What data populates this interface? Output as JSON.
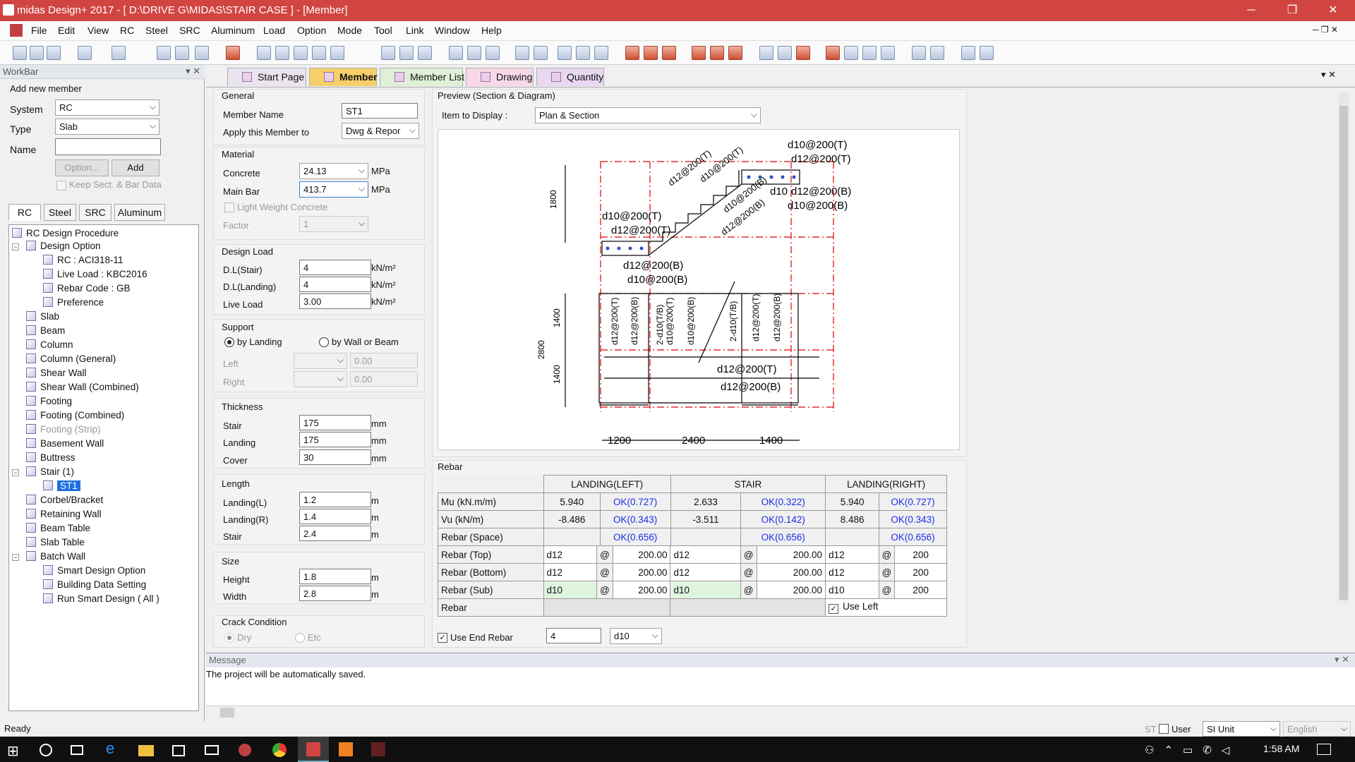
{
  "window": {
    "title": "midas Design+ 2017 - [ D:\\DRIVE G\\MIDAS\\STAIR CASE ] - [Member]",
    "minimize": "─",
    "restore": "❐",
    "close": "✕"
  },
  "menu": [
    "File",
    "Edit",
    "View",
    "RC",
    "Steel",
    "SRC",
    "Aluminum",
    "Load",
    "Option",
    "Mode",
    "Tool",
    "Link",
    "Window",
    "Help"
  ],
  "workbar": {
    "title": "WorkBar",
    "add_new_member": "Add new member",
    "system_label": "System",
    "system_value": "RC",
    "type_label": "Type",
    "type_value": "Slab",
    "name_label": "Name",
    "name_value": "",
    "option_button": "Option...",
    "add_button": "Add",
    "keep_sect": "Keep Sect. & Bar Data",
    "tabs": [
      "RC",
      "Steel",
      "SRC",
      "Aluminum"
    ],
    "tree": {
      "root": "RC Design Procedure",
      "design_option": "Design Option",
      "design_option_children": [
        "RC : ACI318-11",
        "Live Load : KBC2016",
        "Rebar Code : GB",
        "Preference"
      ],
      "items_a": [
        "Slab",
        "Beam",
        "Column",
        "Column (General)",
        "Shear Wall",
        "Shear Wall (Combined)",
        "Footing",
        "Footing (Combined)",
        "Footing (Strip)",
        "Basement Wall",
        "Buttress"
      ],
      "stair": "Stair (1)",
      "stair_child": "ST1",
      "items_b": [
        "Corbel/Bracket",
        "Retaining Wall",
        "Beam Table",
        "Slab Table"
      ],
      "batch": "Batch Wall",
      "batch_children": [
        "Smart Design Option",
        "Building Data Setting",
        "Run Smart Design ( All )"
      ]
    }
  },
  "tabs": [
    "Start Page",
    "Member",
    "Member List",
    "Drawing",
    "Quantity"
  ],
  "general": {
    "title": "General",
    "member_name_label": "Member Name",
    "member_name": "ST1",
    "apply_label": "Apply this Member to",
    "apply_value": "Dwg & Repor"
  },
  "material": {
    "title": "Material",
    "concrete_label": "Concrete",
    "concrete": "24.13",
    "mainbar_label": "Main Bar",
    "mainbar": "413.7",
    "unit": "MPa",
    "lwc": "Light Weight Concrete",
    "factor_label": "Factor",
    "factor": "1"
  },
  "design_load": {
    "title": "Design Load",
    "dl_stair_label": "D.L(Stair)",
    "dl_stair": "4",
    "dl_landing_label": "D.L(Landing)",
    "dl_landing": "4",
    "live_label": "Live Load",
    "live": "3.00",
    "unit": "kN/m²"
  },
  "support": {
    "title": "Support",
    "by_landing": "by Landing",
    "by_wall": "by Wall or Beam",
    "left_label": "Left",
    "left_value": "0.00",
    "right_label": "Right",
    "right_value": "0.00"
  },
  "thickness": {
    "title": "Thickness",
    "stair_label": "Stair",
    "stair": "175",
    "landing_label": "Landing",
    "landing": "175",
    "cover_label": "Cover",
    "cover": "30",
    "unit": "mm"
  },
  "length": {
    "title": "Length",
    "landing_l_label": "Landing(L)",
    "landing_l": "1.2",
    "landing_r_label": "Landing(R)",
    "landing_r": "1.4",
    "stair_label": "Stair",
    "stair": "2.4",
    "unit": "m"
  },
  "size": {
    "title": "Size",
    "height_label": "Height",
    "height": "1.8",
    "width_label": "Width",
    "width": "2.8",
    "unit": "m"
  },
  "crack": {
    "title": "Crack Condition",
    "dry": "Dry",
    "etc": "Etc"
  },
  "preview": {
    "title": "Preview (Section & Diagram)",
    "item_label": "Item to Display :",
    "item_value": "Plan & Section",
    "labels": {
      "d10_200_T": "d10@200(T)",
      "d12_200_T": "d12@200(T)",
      "d10": "d10",
      "d12_200_B": "d12@200(B)",
      "d10_200_B": "d10@200(B)",
      "dim_1800": "1800",
      "dim_1400": "1400",
      "dim_2800": "2800",
      "dim_1200": "1200",
      "dim_2400": "2400",
      "diag_d12_T": "d12@200(T)",
      "diag_d10_T": "d10@200(T)",
      "diag_d10_B": "d10@200(B)",
      "diag_d12_B": "d12@200(B)",
      "v1": "d12@200(T)",
      "v2": "d12@200(B)",
      "v3": "2-d10(T/B)",
      "v4": "d10@200(T)",
      "v5": "d10@200(B)",
      "v6": "2-d10(T/B)",
      "v7": "d12@200(T)",
      "v8": "d12@200(B)"
    }
  },
  "rebar": {
    "title": "Rebar",
    "col_headers": [
      "LANDING(LEFT)",
      "STAIR",
      "LANDING(RIGHT)"
    ],
    "rows": [
      {
        "label": "Mu (kN.m/m)",
        "cells": [
          "5.940",
          "OK(0.727)",
          "2.633",
          "OK(0.322)",
          "5.940",
          "OK(0.727)"
        ]
      },
      {
        "label": "Vu (kN/m)",
        "cells": [
          "-8.486",
          "OK(0.343)",
          "-3.511",
          "OK(0.142)",
          "8.486",
          "OK(0.343)"
        ]
      },
      {
        "label": "Rebar (Space)",
        "cells": [
          "",
          "OK(0.656)",
          "",
          "OK(0.656)",
          "",
          "OK(0.656)"
        ]
      }
    ],
    "bar_rows": [
      {
        "label": "Rebar (Top)",
        "cells": [
          "d12",
          "@",
          "200.00",
          "d12",
          "@",
          "200.00",
          "d12",
          "@",
          "200"
        ]
      },
      {
        "label": "Rebar (Bottom)",
        "cells": [
          "d12",
          "@",
          "200.00",
          "d12",
          "@",
          "200.00",
          "d12",
          "@",
          "200"
        ]
      },
      {
        "label": "Rebar (Sub)",
        "cells": [
          "d10",
          "@",
          "200.00",
          "d10",
          "@",
          "200.00",
          "d10",
          "@",
          "200"
        ]
      }
    ],
    "last_row_label": "Rebar",
    "use_left": "Use Left",
    "use_end_rebar": "Use End Rebar",
    "end_count": "4",
    "end_bar": "d10"
  },
  "message": {
    "title": "Message",
    "text": "The project will be automatically saved."
  },
  "status": {
    "ready": "Ready",
    "st": "ST",
    "user": "User",
    "unit": "SI Unit",
    "lang": "English"
  },
  "taskbar": {
    "time": "1:58 AM"
  },
  "colors": {
    "title_bar": "#d04542",
    "ok_text": "#1a2ee8",
    "active_tab": "#f0c860"
  }
}
